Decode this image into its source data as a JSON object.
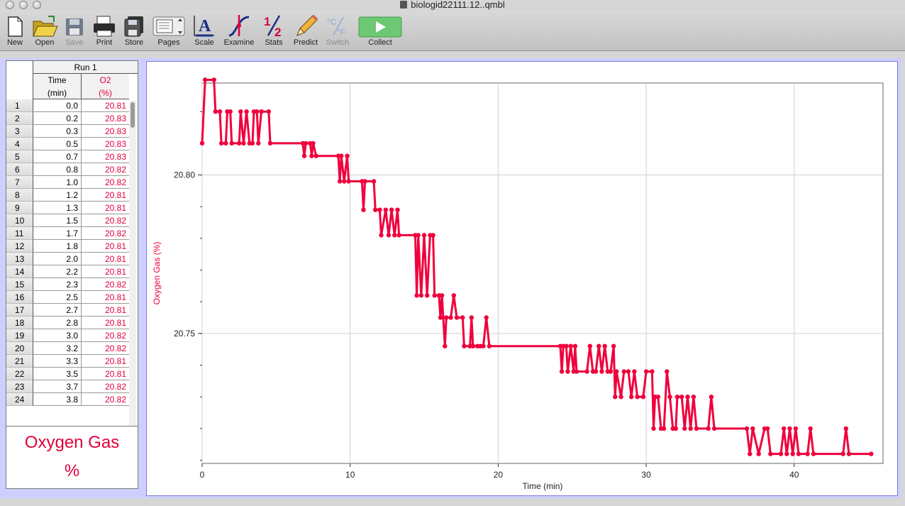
{
  "window": {
    "title": "biologid22111.12..qmbl"
  },
  "toolbar": {
    "items": [
      {
        "label": "New",
        "icon": "new-document-icon",
        "disabled": false
      },
      {
        "label": "Open",
        "icon": "folder-open-icon",
        "disabled": false
      },
      {
        "label": "Save",
        "icon": "floppy-disk-icon",
        "disabled": true
      },
      {
        "label": "Print",
        "icon": "printer-icon",
        "disabled": false
      },
      {
        "label": "Store",
        "icon": "store-icon",
        "disabled": false
      },
      {
        "label": "Pages",
        "icon": "pages-icon",
        "disabled": false
      },
      {
        "label": "Scale",
        "icon": "scale-icon",
        "disabled": false
      },
      {
        "label": "Examine",
        "icon": "examine-icon",
        "disabled": false
      },
      {
        "label": "Stats",
        "icon": "stats-icon",
        "disabled": false
      },
      {
        "label": "Predict",
        "icon": "pencil-icon",
        "disabled": false
      },
      {
        "label": "Switch",
        "icon": "temperature-switch-icon",
        "disabled": true
      },
      {
        "label": "Collect",
        "icon": "play-icon",
        "disabled": false
      }
    ]
  },
  "table": {
    "run_label": "Run 1",
    "col_time": {
      "name": "Time",
      "unit": "(min)"
    },
    "col_o2": {
      "name": "O2",
      "unit": "(%)"
    },
    "rows": [
      [
        "1",
        "0.0",
        "20.81"
      ],
      [
        "2",
        "0.2",
        "20.83"
      ],
      [
        "3",
        "0.3",
        "20.83"
      ],
      [
        "4",
        "0.5",
        "20.83"
      ],
      [
        "5",
        "0.7",
        "20.83"
      ],
      [
        "6",
        "0.8",
        "20.82"
      ],
      [
        "7",
        "1.0",
        "20.82"
      ],
      [
        "8",
        "1.2",
        "20.81"
      ],
      [
        "9",
        "1.3",
        "20.81"
      ],
      [
        "10",
        "1.5",
        "20.82"
      ],
      [
        "11",
        "1.7",
        "20.82"
      ],
      [
        "12",
        "1.8",
        "20.81"
      ],
      [
        "13",
        "2.0",
        "20.81"
      ],
      [
        "14",
        "2.2",
        "20.81"
      ],
      [
        "15",
        "2.3",
        "20.82"
      ],
      [
        "16",
        "2.5",
        "20.81"
      ],
      [
        "17",
        "2.7",
        "20.81"
      ],
      [
        "18",
        "2.8",
        "20.81"
      ],
      [
        "19",
        "3.0",
        "20.82"
      ],
      [
        "20",
        "3.2",
        "20.82"
      ],
      [
        "21",
        "3.3",
        "20.81"
      ],
      [
        "22",
        "3.5",
        "20.81"
      ],
      [
        "23",
        "3.7",
        "20.82"
      ],
      [
        "24",
        "3.8",
        "20.82"
      ]
    ]
  },
  "meter": {
    "label": "Oxygen Gas",
    "unit": "%"
  },
  "chart_data": {
    "type": "line",
    "xlabel": "Time (min)",
    "ylabel": "Oxygen Gas (%)",
    "xlim": [
      0,
      46
    ],
    "ylim": [
      20.709,
      20.829
    ],
    "xticks": [
      0,
      10,
      20,
      30,
      40
    ],
    "yticks": [
      20.75,
      20.8
    ],
    "grid": true,
    "color": "#f0003c",
    "series": [
      {
        "name": "",
        "points": [
          [
            0.0,
            20.81
          ],
          [
            0.2,
            20.83
          ],
          [
            0.8,
            20.83
          ],
          [
            0.9,
            20.82
          ],
          [
            1.2,
            20.82
          ],
          [
            1.3,
            20.81
          ],
          [
            1.6,
            20.81
          ],
          [
            1.7,
            20.82
          ],
          [
            1.9,
            20.82
          ],
          [
            2.0,
            20.81
          ],
          [
            2.5,
            20.81
          ],
          [
            2.6,
            20.82
          ],
          [
            2.8,
            20.81
          ],
          [
            3.0,
            20.82
          ],
          [
            3.2,
            20.81
          ],
          [
            3.4,
            20.81
          ],
          [
            3.5,
            20.82
          ],
          [
            3.7,
            20.82
          ],
          [
            3.8,
            20.81
          ],
          [
            4.0,
            20.82
          ],
          [
            4.5,
            20.82
          ],
          [
            4.6,
            20.81
          ],
          [
            6.8,
            20.81
          ],
          [
            6.9,
            20.806
          ],
          [
            7.0,
            20.81
          ],
          [
            7.3,
            20.81
          ],
          [
            7.4,
            20.806
          ],
          [
            7.5,
            20.81
          ],
          [
            7.7,
            20.806
          ],
          [
            9.2,
            20.806
          ],
          [
            9.3,
            20.798
          ],
          [
            9.4,
            20.806
          ],
          [
            9.6,
            20.798
          ],
          [
            9.8,
            20.806
          ],
          [
            9.9,
            20.798
          ],
          [
            10.8,
            20.798
          ],
          [
            10.9,
            20.789
          ],
          [
            11.0,
            20.798
          ],
          [
            11.6,
            20.798
          ],
          [
            11.7,
            20.789
          ],
          [
            12.0,
            20.789
          ],
          [
            12.1,
            20.781
          ],
          [
            12.4,
            20.789
          ],
          [
            12.6,
            20.781
          ],
          [
            12.8,
            20.789
          ],
          [
            13.0,
            20.781
          ],
          [
            13.2,
            20.789
          ],
          [
            13.3,
            20.781
          ],
          [
            14.4,
            20.781
          ],
          [
            14.5,
            20.762
          ],
          [
            14.6,
            20.781
          ],
          [
            14.8,
            20.762
          ],
          [
            15.0,
            20.781
          ],
          [
            15.2,
            20.762
          ],
          [
            15.4,
            20.781
          ],
          [
            15.6,
            20.781
          ],
          [
            15.7,
            20.762
          ],
          [
            16.0,
            20.762
          ],
          [
            16.1,
            20.755
          ],
          [
            16.2,
            20.762
          ],
          [
            16.4,
            20.746
          ],
          [
            16.5,
            20.755
          ],
          [
            16.8,
            20.755
          ],
          [
            17.0,
            20.762
          ],
          [
            17.2,
            20.755
          ],
          [
            17.6,
            20.755
          ],
          [
            17.7,
            20.746
          ],
          [
            18.1,
            20.746
          ],
          [
            18.2,
            20.755
          ],
          [
            18.3,
            20.746
          ],
          [
            18.6,
            20.746
          ],
          [
            18.8,
            20.746
          ],
          [
            19.0,
            20.746
          ],
          [
            19.2,
            20.755
          ],
          [
            19.4,
            20.746
          ],
          [
            24.2,
            20.746
          ],
          [
            24.3,
            20.738
          ],
          [
            24.4,
            20.746
          ],
          [
            24.6,
            20.746
          ],
          [
            24.7,
            20.738
          ],
          [
            24.9,
            20.746
          ],
          [
            25.1,
            20.738
          ],
          [
            25.2,
            20.746
          ],
          [
            25.3,
            20.738
          ],
          [
            26.0,
            20.738
          ],
          [
            26.2,
            20.746
          ],
          [
            26.4,
            20.738
          ],
          [
            26.6,
            20.738
          ],
          [
            26.8,
            20.746
          ],
          [
            27.0,
            20.738
          ],
          [
            27.2,
            20.746
          ],
          [
            27.4,
            20.738
          ],
          [
            27.6,
            20.738
          ],
          [
            27.8,
            20.746
          ],
          [
            27.9,
            20.73
          ],
          [
            28.0,
            20.738
          ],
          [
            28.3,
            20.73
          ],
          [
            28.5,
            20.738
          ],
          [
            28.8,
            20.738
          ],
          [
            29.0,
            20.73
          ],
          [
            29.2,
            20.738
          ],
          [
            29.4,
            20.73
          ],
          [
            29.8,
            20.73
          ],
          [
            30.0,
            20.738
          ],
          [
            30.4,
            20.738
          ],
          [
            30.5,
            20.72
          ],
          [
            30.6,
            20.73
          ],
          [
            30.8,
            20.73
          ],
          [
            31.0,
            20.72
          ],
          [
            31.2,
            20.72
          ],
          [
            31.4,
            20.738
          ],
          [
            31.6,
            20.73
          ],
          [
            31.8,
            20.72
          ],
          [
            32.0,
            20.72
          ],
          [
            32.1,
            20.73
          ],
          [
            32.4,
            20.73
          ],
          [
            32.6,
            20.72
          ],
          [
            32.8,
            20.73
          ],
          [
            33.0,
            20.72
          ],
          [
            33.2,
            20.73
          ],
          [
            33.4,
            20.72
          ],
          [
            34.2,
            20.72
          ],
          [
            34.4,
            20.73
          ],
          [
            34.6,
            20.72
          ],
          [
            36.8,
            20.72
          ],
          [
            37.0,
            20.712
          ],
          [
            37.2,
            20.72
          ],
          [
            37.6,
            20.712
          ],
          [
            38.0,
            20.72
          ],
          [
            38.2,
            20.72
          ],
          [
            38.4,
            20.712
          ],
          [
            39.1,
            20.712
          ],
          [
            39.3,
            20.72
          ],
          [
            39.5,
            20.712
          ],
          [
            39.7,
            20.72
          ],
          [
            39.9,
            20.712
          ],
          [
            40.1,
            20.72
          ],
          [
            40.3,
            20.712
          ],
          [
            40.9,
            20.712
          ],
          [
            41.1,
            20.72
          ],
          [
            41.3,
            20.712
          ],
          [
            43.3,
            20.712
          ],
          [
            43.5,
            20.72
          ],
          [
            43.7,
            20.712
          ],
          [
            45.2,
            20.712
          ]
        ]
      }
    ]
  }
}
